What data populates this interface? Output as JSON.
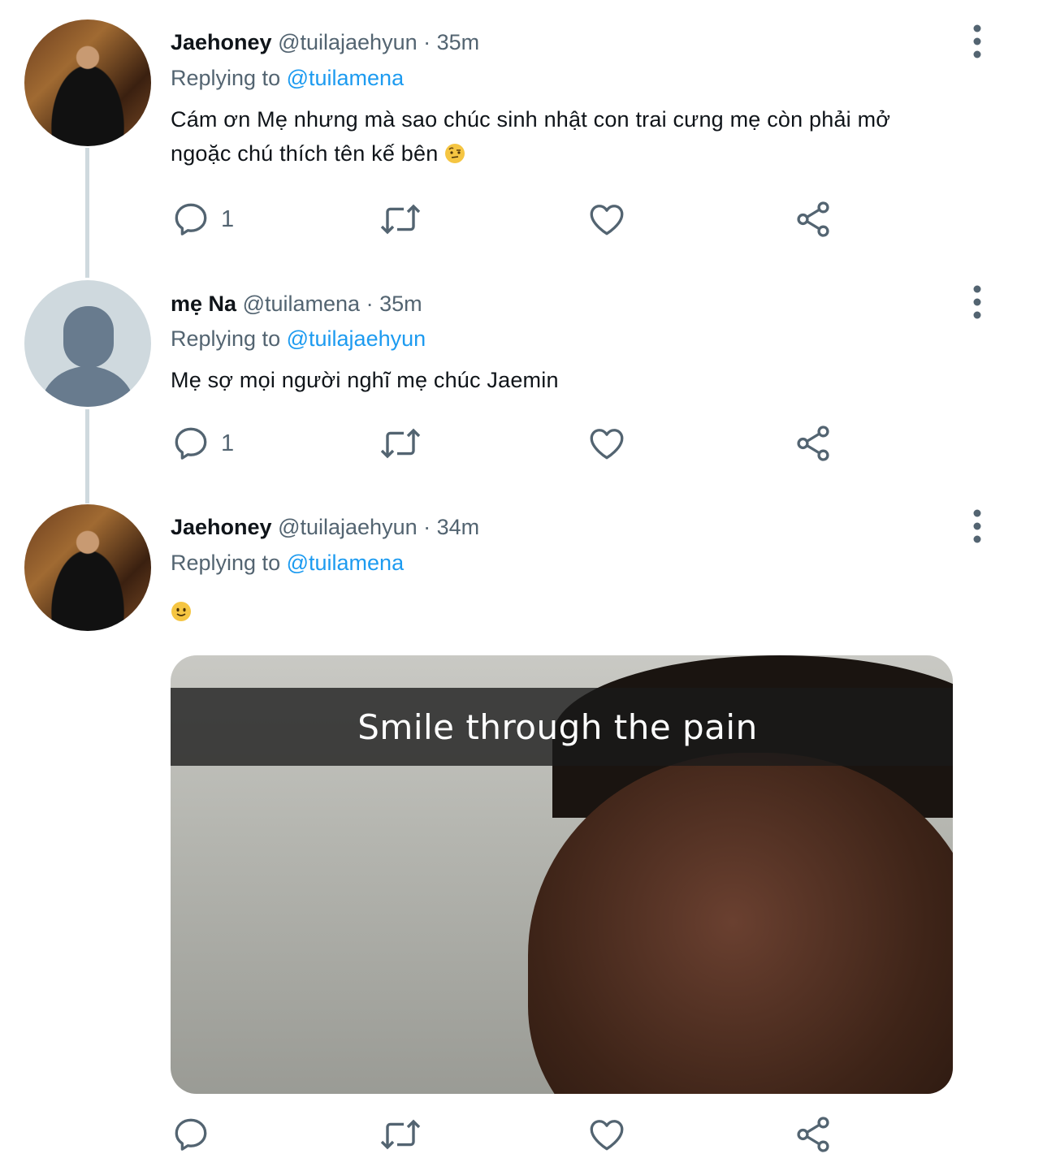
{
  "tweets": [
    {
      "name": "Jaehoney",
      "handle": "@tuilajaehyun",
      "separator": "·",
      "time": "35m",
      "replying_prefix": "Replying to",
      "replying_to": "@tuilamena",
      "text": "Cám ơn Mẹ nhưng mà sao chúc sinh nhật con trai cưng mẹ còn phải mở ngoặc chú thích tên kế bên",
      "emoji": "raised-eyebrow-emoji",
      "reply_count": "1",
      "avatar": "profile-photo"
    },
    {
      "name": "mẹ Na",
      "handle": "@tuilamena",
      "separator": "·",
      "time": "35m",
      "replying_prefix": "Replying to",
      "replying_to": "@tuilajaehyun",
      "text": "Mẹ sợ mọi người nghĩ mẹ chúc Jaemin",
      "reply_count": "1",
      "avatar": "default-avatar"
    },
    {
      "name": "Jaehoney",
      "handle": "@tuilajaehyun",
      "separator": "·",
      "time": "34m",
      "replying_prefix": "Replying to",
      "replying_to": "@tuilamena",
      "emoji": "slightly-smiling-face-emoji",
      "media_caption": "Smile through the pain",
      "reply_count": "",
      "avatar": "profile-photo"
    }
  ],
  "icons": {
    "reply": "reply-icon",
    "retweet": "retweet-icon",
    "like": "heart-icon",
    "share": "share-icon",
    "more": "more-vertical-icon"
  },
  "colors": {
    "text": "#0f1419",
    "secondary": "#536471",
    "link": "#1d9bf0",
    "thread_line": "#cfd9de"
  }
}
